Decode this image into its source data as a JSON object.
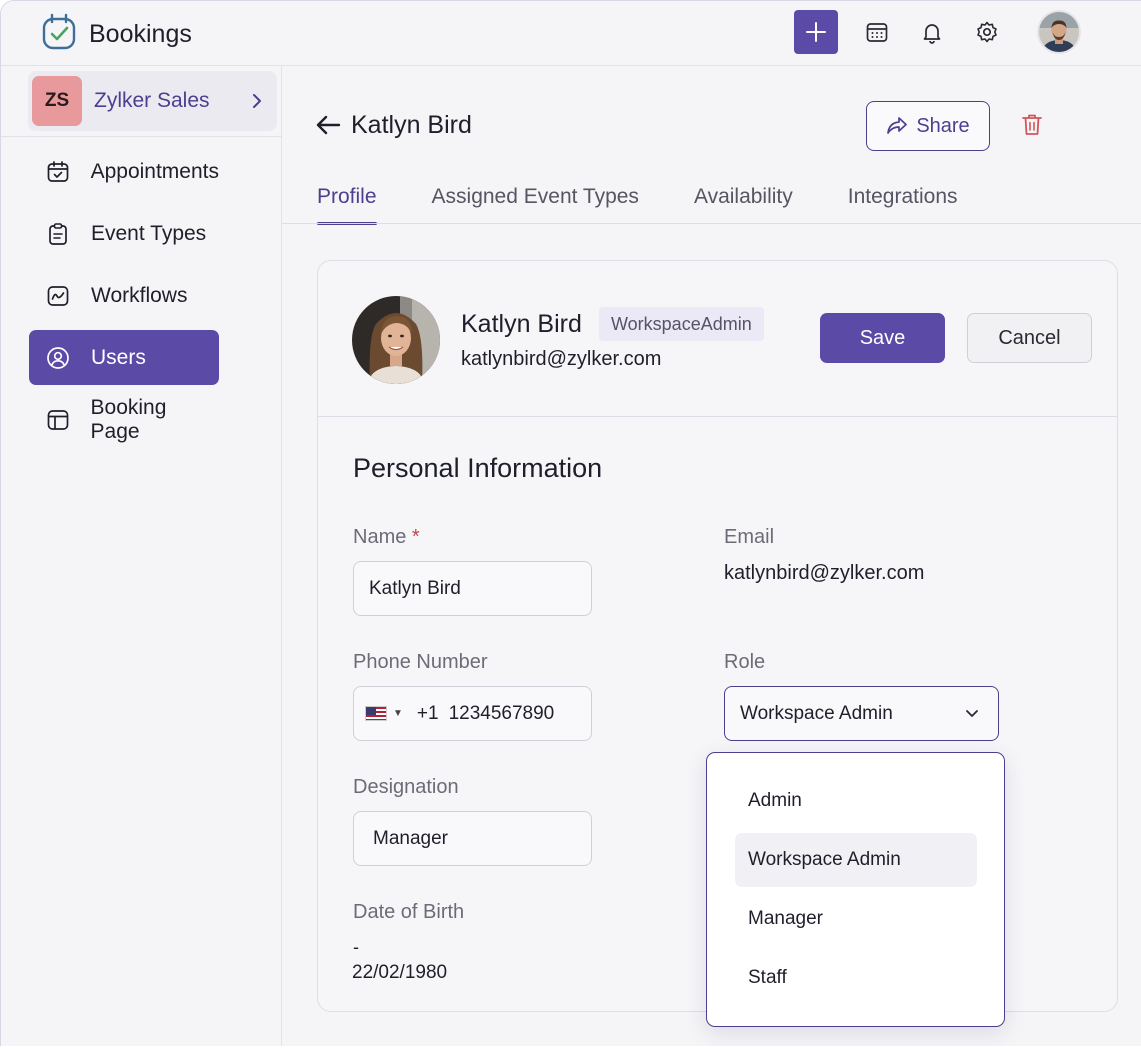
{
  "app": {
    "title": "Bookings",
    "colors": {
      "accent": "#5b4ba7",
      "accent_text": "#4c3f8f",
      "danger": "#d0565c",
      "org_badge": "#e8999c"
    }
  },
  "topbar": {
    "icons": [
      "plus-icon",
      "calendar-icon",
      "bell-icon",
      "gear-icon",
      "user-avatar"
    ]
  },
  "sidebar": {
    "org": {
      "initials": "ZS",
      "name": "Zylker Sales"
    },
    "items": [
      {
        "label": "Appointments",
        "icon": "calendar-check-icon"
      },
      {
        "label": "Event Types",
        "icon": "clipboard-icon"
      },
      {
        "label": "Workflows",
        "icon": "workflow-icon"
      },
      {
        "label": "Users",
        "icon": "user-circle-icon",
        "active": true
      },
      {
        "label": "Booking Page",
        "icon": "layout-icon"
      }
    ]
  },
  "page": {
    "title": "Katlyn Bird",
    "share_label": "Share",
    "tabs": [
      "Profile",
      "Assigned Event Types",
      "Availability",
      "Integrations"
    ],
    "active_tab": "Profile"
  },
  "profile": {
    "name": "Katlyn Bird",
    "role_badge": "WorkspaceAdmin",
    "email": "katlynbird@zylker.com",
    "save_label": "Save",
    "cancel_label": "Cancel"
  },
  "personal": {
    "section_title": "Personal Information",
    "name_label": "Name",
    "name_required": "*",
    "name_value": "Katlyn Bird",
    "email_label": "Email",
    "email_value": "katlynbird@zylker.com",
    "phone_label": "Phone Number",
    "phone_code": "+1",
    "phone_value": "1234567890",
    "role_label": "Role",
    "role_value": "Workspace Admin",
    "designation_label": "Designation",
    "designation_value": "Manager",
    "dob_label": "Date of Birth",
    "dob_dash": "-",
    "dob_value": "22/02/1980"
  },
  "role_dropdown": {
    "options": [
      "Admin",
      "Workspace Admin",
      "Manager",
      "Staff"
    ],
    "selected": "Workspace Admin"
  }
}
